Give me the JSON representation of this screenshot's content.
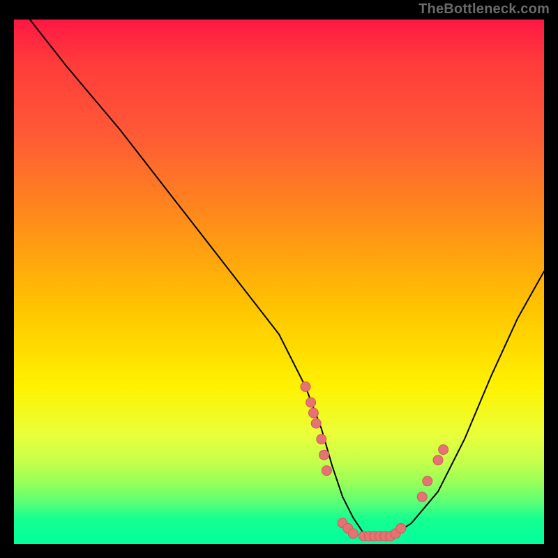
{
  "watermark": "TheBottleneck.com",
  "colors": {
    "dot_fill": "#e57373",
    "dot_stroke": "#d15a5a",
    "curve": "#000000",
    "background": "#000000"
  },
  "chart_data": {
    "type": "line",
    "title": "",
    "xlabel": "",
    "ylabel": "",
    "xlim": [
      0,
      100
    ],
    "ylim": [
      0,
      100
    ],
    "series": [
      {
        "name": "curve",
        "x": [
          3,
          10,
          20,
          30,
          40,
          50,
          55,
          58,
          60,
          62,
          64,
          66,
          68,
          70,
          72,
          75,
          80,
          85,
          90,
          95,
          100
        ],
        "y": [
          100,
          91,
          79,
          66,
          53,
          40,
          30,
          22,
          15,
          9,
          5,
          2,
          1,
          1,
          2,
          4,
          10,
          20,
          32,
          43,
          52
        ]
      }
    ],
    "points": [
      {
        "x": 55,
        "y": 30
      },
      {
        "x": 56,
        "y": 27
      },
      {
        "x": 56.5,
        "y": 25
      },
      {
        "x": 57,
        "y": 23
      },
      {
        "x": 58,
        "y": 20
      },
      {
        "x": 58.5,
        "y": 17
      },
      {
        "x": 59,
        "y": 14
      },
      {
        "x": 62,
        "y": 4
      },
      {
        "x": 63,
        "y": 3
      },
      {
        "x": 64,
        "y": 2
      },
      {
        "x": 66,
        "y": 1.5
      },
      {
        "x": 67,
        "y": 1.5
      },
      {
        "x": 68,
        "y": 1.5
      },
      {
        "x": 69,
        "y": 1.5
      },
      {
        "x": 70,
        "y": 1.5
      },
      {
        "x": 71,
        "y": 1.5
      },
      {
        "x": 72,
        "y": 2
      },
      {
        "x": 73,
        "y": 3
      },
      {
        "x": 77,
        "y": 9
      },
      {
        "x": 78,
        "y": 12
      },
      {
        "x": 80,
        "y": 16
      },
      {
        "x": 81,
        "y": 18
      }
    ]
  }
}
